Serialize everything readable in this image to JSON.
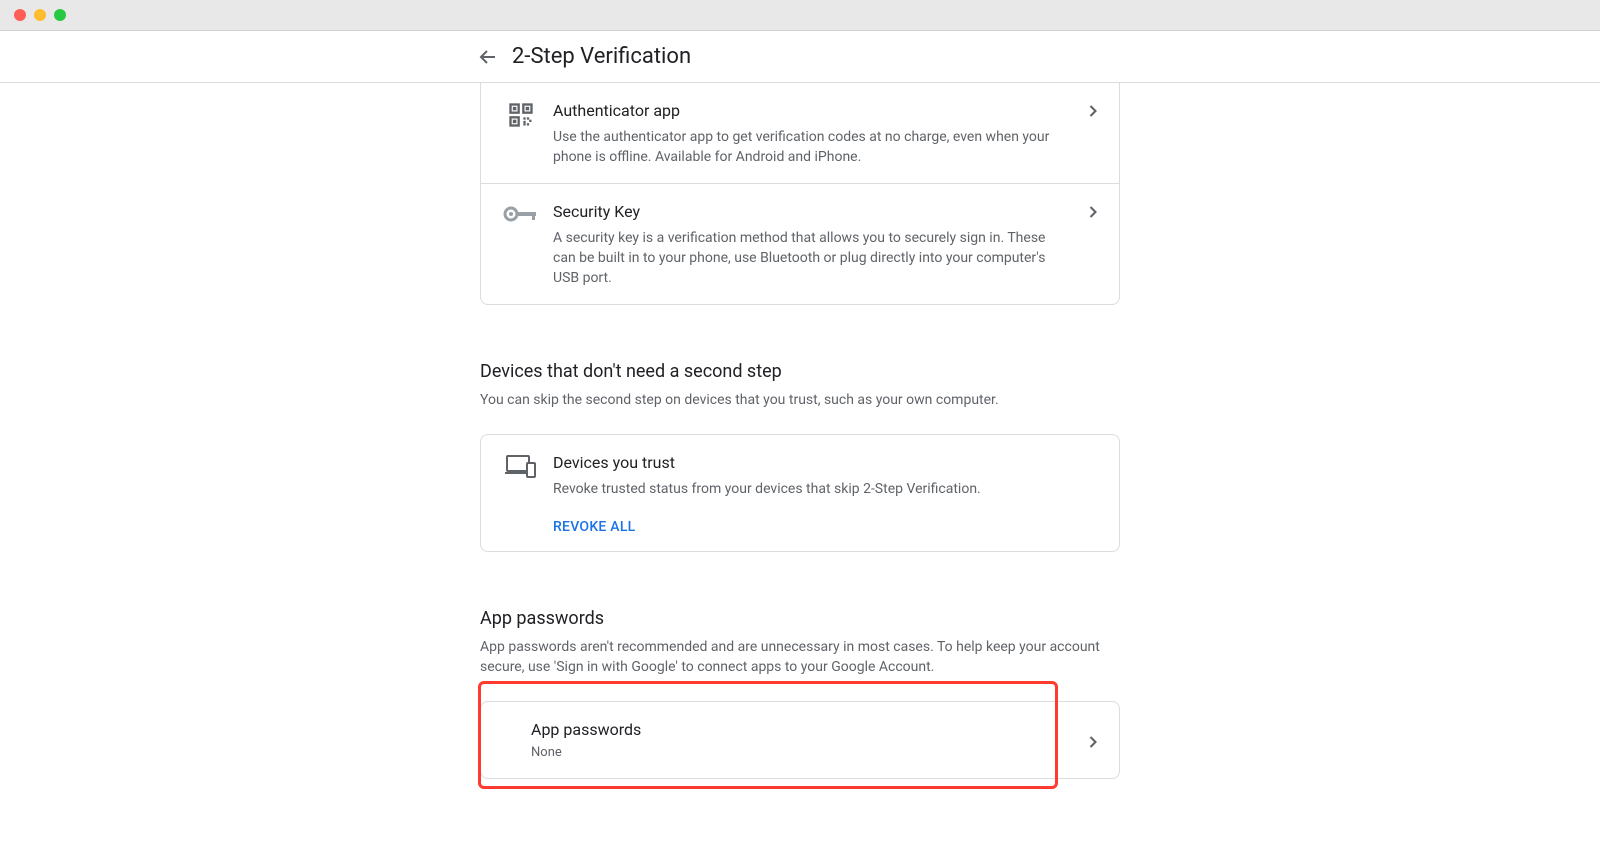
{
  "header": {
    "title": "2-Step Verification"
  },
  "second_steps": {
    "items": [
      {
        "title": "Authenticator app",
        "desc": "Use the authenticator app to get verification codes at no charge, even when your phone is offline. Available for Android and iPhone."
      },
      {
        "title": "Security Key",
        "desc": "A security key is a verification method that allows you to securely sign in. These can be built in to your phone, use Bluetooth or plug directly into your computer's USB port."
      }
    ]
  },
  "trusted_devices": {
    "heading": "Devices that don't need a second step",
    "desc": "You can skip the second step on devices that you trust, such as your own computer.",
    "card": {
      "title": "Devices you trust",
      "desc": "Revoke trusted status from your devices that skip 2-Step Verification.",
      "action": "REVOKE ALL"
    }
  },
  "app_passwords": {
    "heading": "App passwords",
    "desc": "App passwords aren't recommended and are unnecessary in most cases. To help keep your account secure, use 'Sign in with Google' to connect apps to your Google Account.",
    "card": {
      "title": "App passwords",
      "value": "None"
    }
  }
}
